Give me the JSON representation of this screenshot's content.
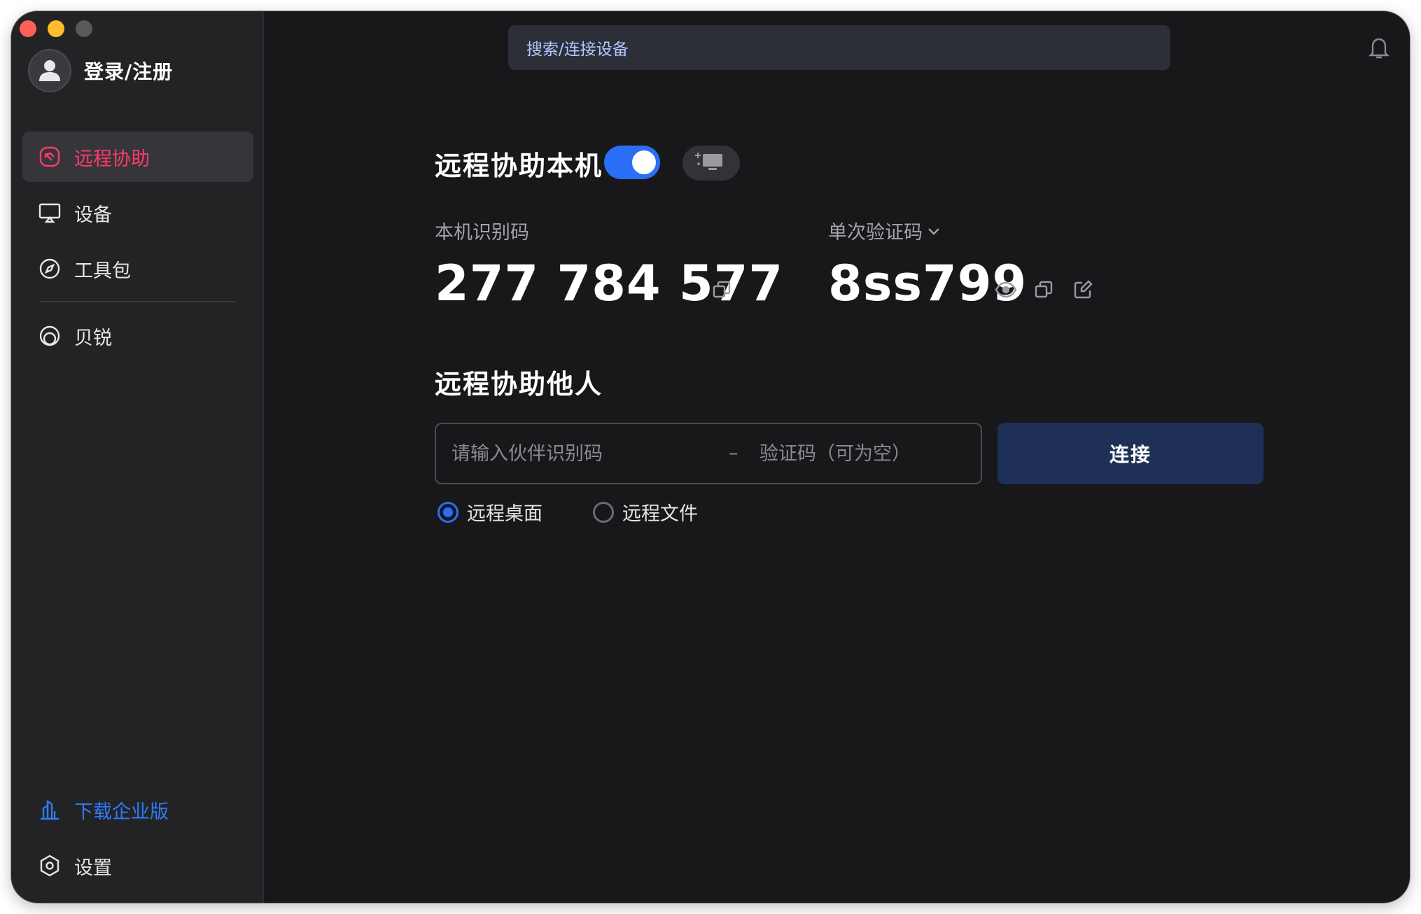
{
  "profile": {
    "label": "登录/注册"
  },
  "sidebar": {
    "items": [
      {
        "label": "远程协助",
        "icon": "remote-assist-icon",
        "active": true
      },
      {
        "label": "设备",
        "icon": "monitor-icon",
        "active": false
      },
      {
        "label": "工具包",
        "icon": "compass-icon",
        "active": false
      },
      {
        "label": "贝锐",
        "icon": "oray-icon",
        "active": false
      }
    ],
    "enterprise": {
      "label": "下载企业版",
      "icon": "building-icon"
    },
    "settings": {
      "label": "设置",
      "icon": "gear-icon"
    }
  },
  "search": {
    "placeholder": "搜索/连接设备"
  },
  "host": {
    "title": "远程协助本机",
    "enabled": true,
    "id_label": "本机识别码",
    "id_value": "277 784 577",
    "otp_label": "单次验证码",
    "otp_value": "8ss799"
  },
  "guest": {
    "title": "远程协助他人",
    "partner_placeholder": "请输入伙伴识别码",
    "separator": "–",
    "code_placeholder": "验证码（可为空）",
    "connect_label": "连接",
    "modes": [
      {
        "label": "远程桌面",
        "checked": true
      },
      {
        "label": "远程文件",
        "checked": false
      }
    ]
  },
  "colors": {
    "accent": "#2b6ef6",
    "active_nav": "#ff3b6b",
    "enterprise_link": "#2f7bf6",
    "connect_button": "#1e3056",
    "background": "#18181b",
    "sidebar": "#232326"
  }
}
